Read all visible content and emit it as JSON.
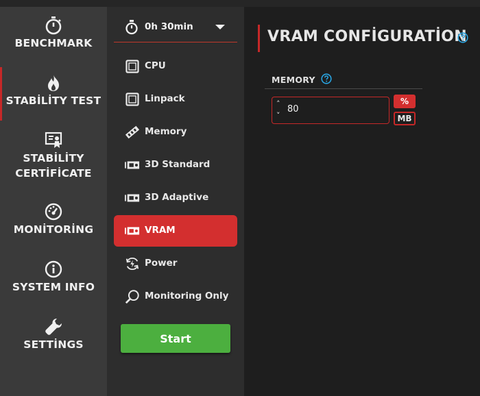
{
  "nav": {
    "items": [
      {
        "label": "BENCHMARK",
        "icon": "stopwatch-icon"
      },
      {
        "label": "STABİLİTY TEST",
        "icon": "flame-icon",
        "active": true
      },
      {
        "label": "STABİLİTY\nCERTİFİCATE",
        "line1": "STABİLİTY",
        "line2": "CERTİFİCATE",
        "icon": "certificate-icon"
      },
      {
        "label": "MONİTORİNG",
        "icon": "gauge-icon"
      },
      {
        "label": "SYSTEM INFO",
        "icon": "info-icon"
      },
      {
        "label": "SETTİNGS",
        "icon": "wrench-icon"
      }
    ]
  },
  "duration": {
    "value": "0h 30min"
  },
  "tests": [
    {
      "label": "CPU",
      "icon": "cpu-icon"
    },
    {
      "label": "Linpack",
      "icon": "cpu-icon"
    },
    {
      "label": "Memory",
      "icon": "memory-icon"
    },
    {
      "label": "3D Standard",
      "icon": "gpu-icon"
    },
    {
      "label": "3D Adaptive",
      "icon": "gpu-icon"
    },
    {
      "label": "VRAM",
      "icon": "gpu-icon",
      "active": true
    },
    {
      "label": "Power",
      "icon": "power-icon"
    },
    {
      "label": "Monitoring Only",
      "icon": "magnifier-icon"
    }
  ],
  "start_label": "Start",
  "config": {
    "title": "VRAM CONFİGURATİON",
    "memory_label": "MEMORY",
    "memory_value": "80",
    "unit_percent": "%",
    "unit_mb": "MB",
    "selected_unit": "%"
  },
  "colors": {
    "accent": "#d32f2f",
    "start": "#4caf3f",
    "help": "#29a3e0",
    "nav_bg": "#3a3a3a",
    "panel_bg": "#2d2d2d",
    "content_bg": "#1e1e1e"
  }
}
